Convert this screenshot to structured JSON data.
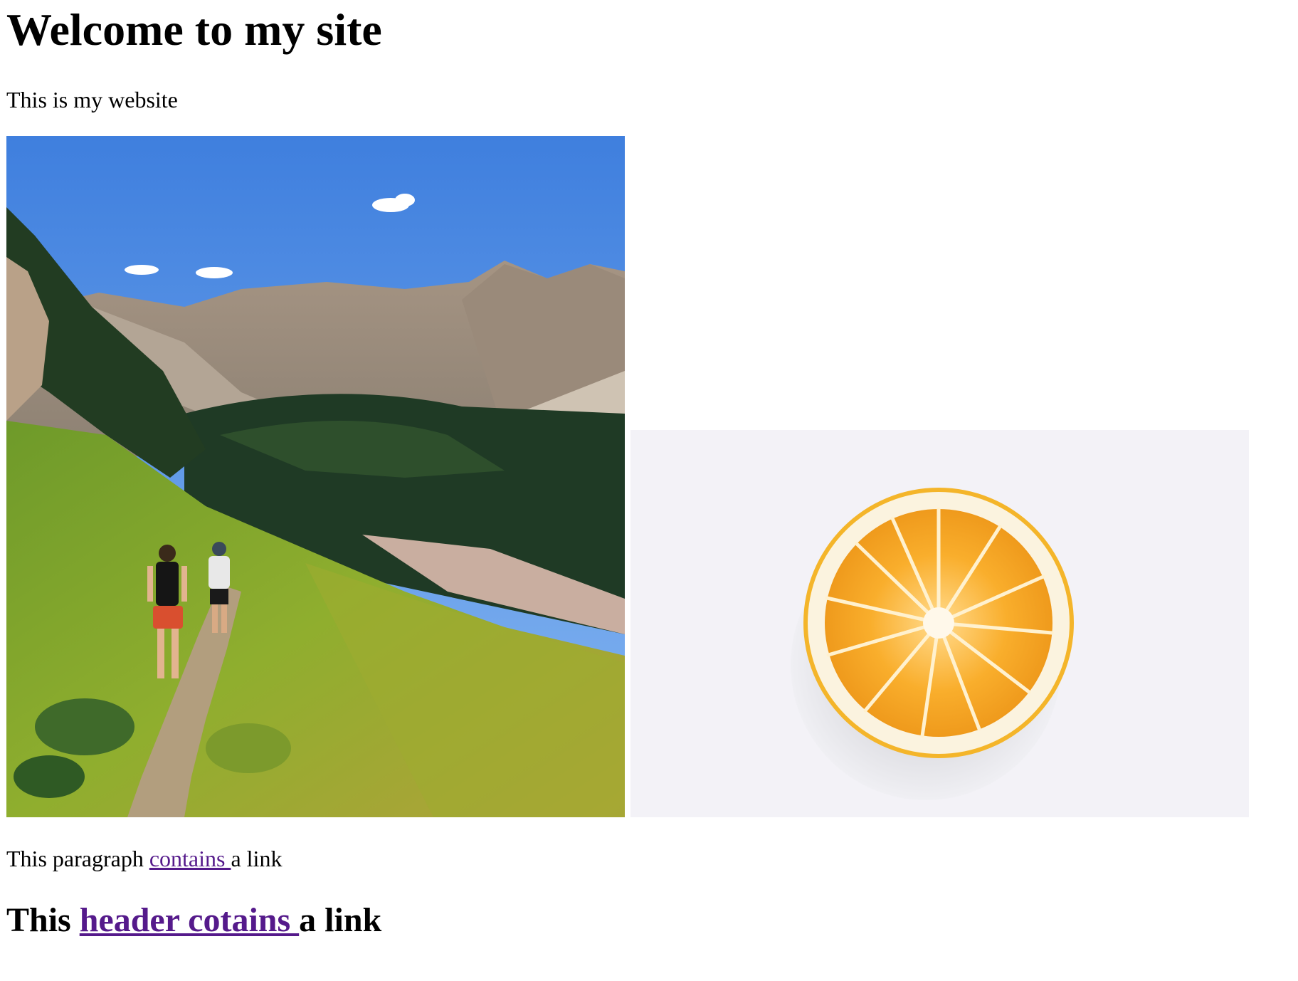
{
  "heading": "Welcome to my site",
  "intro": "This is my website",
  "images": {
    "mountain_alt": "Two hikers on a trail through a green alpine meadow below rocky mountains",
    "orange_alt": "Half of an orange cut in cross-section"
  },
  "paragraph": {
    "before": "This paragraph ",
    "link": "contains ",
    "after": "a link"
  },
  "subheading": {
    "before": "This ",
    "link": "header cotains ",
    "after": "a link"
  },
  "colors": {
    "visited_link": "#551a8b",
    "text": "#000000",
    "background": "#ffffff"
  }
}
